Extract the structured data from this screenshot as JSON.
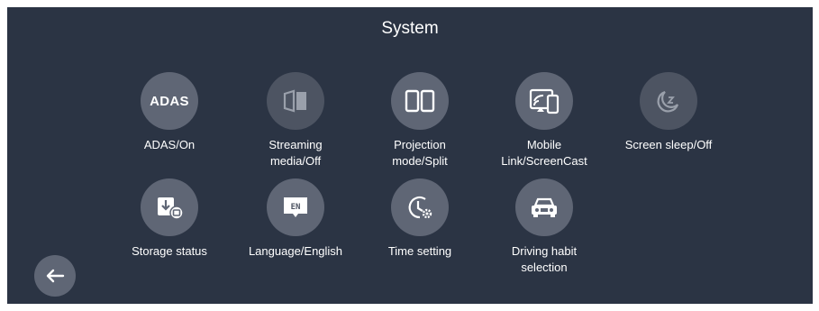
{
  "header": {
    "title": "System"
  },
  "items": [
    {
      "icon_name": "adas-icon",
      "icon_text": "ADAS",
      "label": "ADAS/On"
    },
    {
      "icon_name": "streaming-media-icon",
      "label": "Streaming\nmedia/Off"
    },
    {
      "icon_name": "split-screen-icon",
      "label": "Projection\nmode/Split"
    },
    {
      "icon_name": "screencast-icon",
      "label": "Mobile\nLink/ScreenCast"
    },
    {
      "icon_name": "screen-sleep-icon",
      "label": "Screen sleep/Off"
    },
    {
      "icon_name": "storage-icon",
      "label": "Storage status"
    },
    {
      "icon_name": "language-icon",
      "icon_text": "EN",
      "label": "Language/English"
    },
    {
      "icon_name": "clock-settings-icon",
      "label": "Time setting"
    },
    {
      "icon_name": "car-icon",
      "label": "Driving habit\nselection"
    }
  ],
  "back_button": {
    "icon_name": "back-arrow-icon"
  },
  "colors": {
    "background": "#2b3444",
    "circle": "#5f6675",
    "text": "#ffffff"
  }
}
